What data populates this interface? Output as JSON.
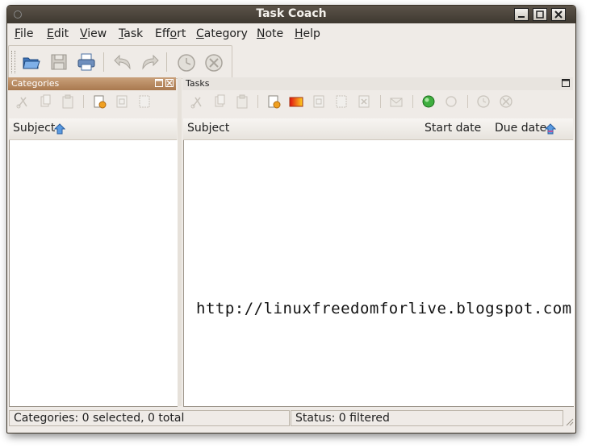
{
  "window": {
    "title": "Task Coach"
  },
  "menubar": {
    "items": [
      {
        "pre": "",
        "u": "F",
        "post": "ile"
      },
      {
        "pre": "",
        "u": "E",
        "post": "dit"
      },
      {
        "pre": "",
        "u": "V",
        "post": "iew"
      },
      {
        "pre": "",
        "u": "T",
        "post": "ask"
      },
      {
        "pre": "Eff",
        "u": "o",
        "post": "rt"
      },
      {
        "pre": "",
        "u": "C",
        "post": "ategory"
      },
      {
        "pre": "",
        "u": "N",
        "post": "ote"
      },
      {
        "pre": "",
        "u": "H",
        "post": "elp"
      }
    ]
  },
  "toolbar": {
    "icons": [
      "open-icon",
      "save-icon",
      "print-icon",
      "undo-icon",
      "redo-icon",
      "start-tracking-icon",
      "stop-tracking-icon"
    ]
  },
  "categories": {
    "caption": "Categories",
    "column_subject": "Subject",
    "sort": "ascending"
  },
  "tasks": {
    "caption": "Tasks",
    "columns": [
      "Subject",
      "Start date",
      "Due date"
    ]
  },
  "watermark": "http://linuxfreedomforlive.blogspot.com",
  "status": {
    "left": "Categories: 0 selected, 0 total",
    "right": "Status: 0 filtered"
  },
  "colors": {
    "titlebar": "#4a433a",
    "category_caption": "#b8895f",
    "window_bg": "#efebe7"
  }
}
